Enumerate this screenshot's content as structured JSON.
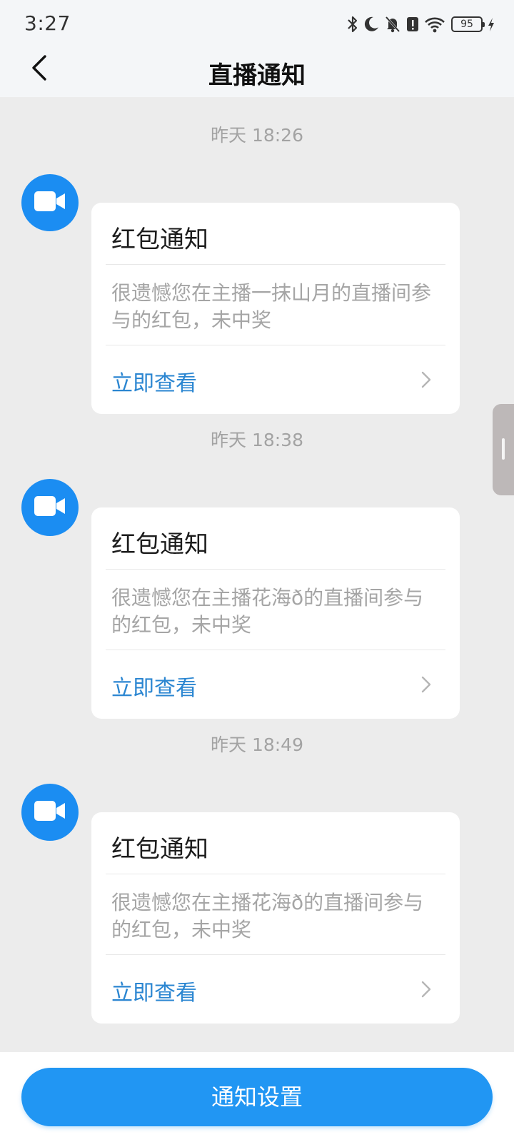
{
  "status_bar": {
    "time": "3:27",
    "battery_level": "95",
    "icons": [
      "bluetooth-icon",
      "moon-icon",
      "bell-off-icon",
      "alert-icon",
      "wifi-icon",
      "battery-icon",
      "charging-icon"
    ]
  },
  "header": {
    "title": "直播通知",
    "back_icon": "chevron-left-icon"
  },
  "messages": [
    {
      "timestamp": "昨天 18:26",
      "title": "红包通知",
      "body": "很遗憾您在主播一抹山月的直播间参与的红包，未中奖",
      "action": "立即查看"
    },
    {
      "timestamp": "昨天 18:38",
      "title": "红包通知",
      "body": "很遗憾您在主播花海ð的直播间参与的红包，未中奖",
      "action": "立即查看"
    },
    {
      "timestamp": "昨天 18:49",
      "title": "红包通知",
      "body": "很遗憾您在主播花海ð的直播间参与的红包，未中奖",
      "action": "立即查看"
    }
  ],
  "footer": {
    "settings_label": "通知设置"
  },
  "colors": {
    "accent": "#2196f3",
    "avatar": "#1b8df2",
    "link": "#2b86d1",
    "background": "#ececec"
  }
}
